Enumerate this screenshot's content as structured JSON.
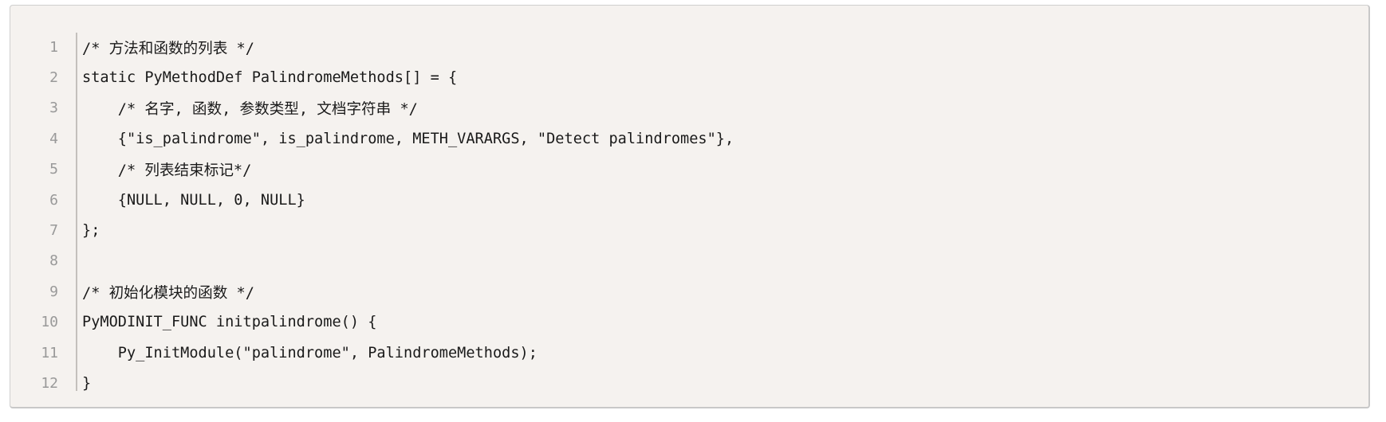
{
  "code": {
    "lines": [
      {
        "number": "1",
        "text": "/* 方法和函数的列表 */"
      },
      {
        "number": "2",
        "text": "static PyMethodDef PalindromeMethods[] = {"
      },
      {
        "number": "3",
        "text": "    /* 名字, 函数, 参数类型, 文档字符串 */"
      },
      {
        "number": "4",
        "text": "    {\"is_palindrome\", is_palindrome, METH_VARARGS, \"Detect palindromes\"},"
      },
      {
        "number": "5",
        "text": "    /* 列表结束标记*/"
      },
      {
        "number": "6",
        "text": "    {NULL, NULL, 0, NULL}"
      },
      {
        "number": "7",
        "text": "};"
      },
      {
        "number": "8",
        "text": ""
      },
      {
        "number": "9",
        "text": "/* 初始化模块的函数 */"
      },
      {
        "number": "10",
        "text": "PyMODINIT_FUNC initpalindrome() {"
      },
      {
        "number": "11",
        "text": "    Py_InitModule(\"palindrome\", PalindromeMethods);"
      },
      {
        "number": "12",
        "text": "}"
      }
    ]
  }
}
